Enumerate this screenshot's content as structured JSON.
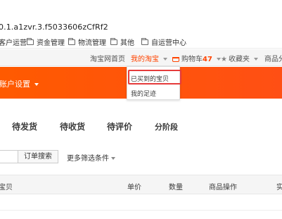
{
  "browser": {
    "url_fragment": "0.1.a1zvr.3.f5033606zCfRf2",
    "bookmarks": [
      {
        "label": "客户运营"
      },
      {
        "label": "资金管理"
      },
      {
        "label": "物流管理"
      },
      {
        "label": "其他"
      },
      {
        "label": "自运营中心"
      }
    ]
  },
  "site_nav": {
    "home": "淘宝网首页",
    "my_taobao": "我的淘宝",
    "cart_label": "购物车",
    "cart_count": "47",
    "favorites": "收藏夹",
    "category": "商品分"
  },
  "banner": {
    "account_settings": "账户设置"
  },
  "dropdown": {
    "items": [
      "已买到的宝贝",
      "我的足迹"
    ]
  },
  "tabs": [
    "待发货",
    "待收货",
    "待评价",
    "分阶段"
  ],
  "search": {
    "button_label": "订单搜索",
    "more_filters": "更多筛选条件"
  },
  "table_header": {
    "columns": [
      "宝贝",
      "单价",
      "数量",
      "商品操作",
      "实"
    ]
  },
  "colors": {
    "accent": "#ff5000",
    "highlight_border": "#e53b3b"
  }
}
